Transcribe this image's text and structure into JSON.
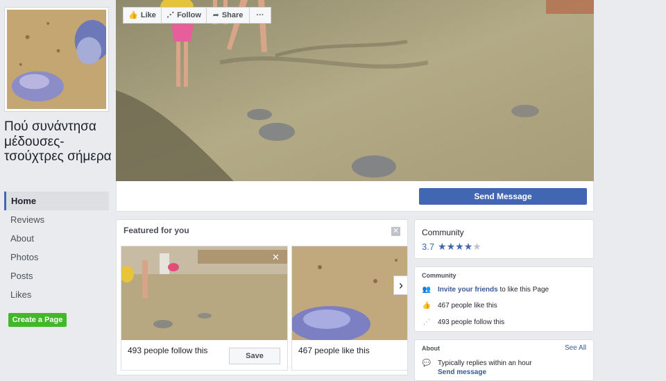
{
  "page": {
    "name": "Πού συνάντησα μέδουσες-τσούχτρες σήμερα"
  },
  "nav": {
    "items": [
      {
        "label": "Home",
        "active": true
      },
      {
        "label": "Reviews"
      },
      {
        "label": "About"
      },
      {
        "label": "Photos"
      },
      {
        "label": "Posts"
      },
      {
        "label": "Likes"
      }
    ],
    "create_page": "Create a Page"
  },
  "actions": {
    "like": "Like",
    "follow": "Follow",
    "share": "Share",
    "more": "···",
    "send_message": "Send Message"
  },
  "featured": {
    "title": "Featured for you",
    "close": "✕",
    "cards": [
      {
        "text": "493 people follow this",
        "save": "Save",
        "close": "✕"
      },
      {
        "text": "467 people like this"
      }
    ],
    "next": "›"
  },
  "community_rating": {
    "title": "Community",
    "value": "3.7",
    "stars": 3.7,
    "star_color": "#4267b2"
  },
  "community": {
    "title": "Community",
    "invite_link": "Invite your friends",
    "invite_rest": " to like this Page",
    "likes": "467 people like this",
    "follows": "493 people follow this"
  },
  "about": {
    "title": "About",
    "see_all": "See All",
    "replies": "Typically replies within an hour",
    "send_message": "Send message"
  },
  "colors": {
    "brand": "#4267b2",
    "background": "#e9ebee",
    "create_page": "#42b72a"
  }
}
